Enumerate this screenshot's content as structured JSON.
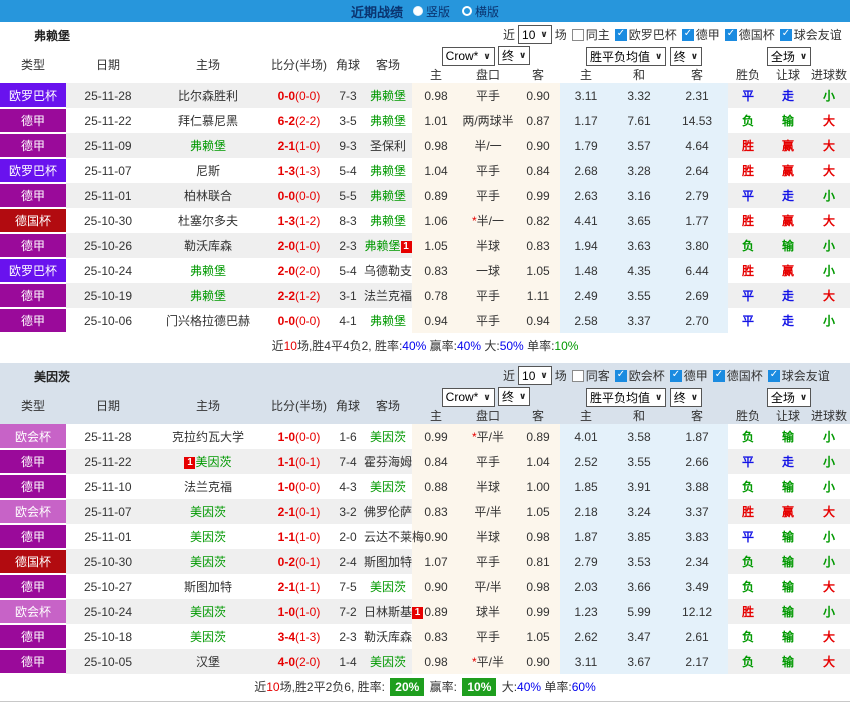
{
  "titlebar": {
    "title": "近期战绩",
    "options": [
      {
        "label": "竖版",
        "selected": true
      },
      {
        "label": "横版",
        "selected": false
      }
    ]
  },
  "colors": {
    "topbar_bg": "#2796dc",
    "title_text": "#0a3470",
    "type_colors": {
      "欧罗巴杯": "#6912ee",
      "德甲": "#9a0a9a",
      "德国杯": "#b20b10",
      "欧会杯": "#c763c7"
    },
    "focus_team": "#009900",
    "score": "#e60000",
    "result_colors": {
      "胜": "#e60000",
      "赢": "#e60000",
      "大": "#e60000",
      "平": "#1414e6",
      "走": "#1414e6",
      "负": "#009900",
      "输": "#009900",
      "小": "#009900"
    },
    "handicap_group_bg": "#fcf6ec",
    "avg_group_bg": "#e4f1fa",
    "stripe": "#efefef",
    "section2_header_bg": "#d8e1eb",
    "summary_highlight_bg": "#1e9e1e"
  },
  "row_fields": [
    "type",
    "date",
    "home",
    "home_is_focus",
    "home_badge",
    "score_ft",
    "score_ht",
    "corner",
    "away",
    "away_is_focus",
    "away_badge",
    "home_odds",
    "handicap_star",
    "handicap",
    "away_odds",
    "avg_win",
    "avg_draw",
    "avg_lose",
    "result",
    "handicap_result",
    "goals_result"
  ],
  "sections": [
    {
      "team": "弗赖堡",
      "filter": {
        "prefix": "近",
        "count": "10",
        "suffix": "场",
        "same_label": "同主",
        "same_checked": false,
        "leagues": [
          {
            "label": "欧罗巴杯",
            "checked": true
          },
          {
            "label": "德甲",
            "checked": true
          },
          {
            "label": "德国杯",
            "checked": true
          },
          {
            "label": "球会友谊",
            "checked": true
          }
        ]
      },
      "header": {
        "cols": [
          "类型",
          "日期",
          "主场",
          "比分(半场)",
          "角球",
          "客场"
        ],
        "dropdowns": [
          "Crow*",
          "终",
          "胜平负均值",
          "终",
          "全场"
        ],
        "subcols": [
          "主",
          "盘口",
          "客",
          "主",
          "和",
          "客",
          "胜负",
          "让球",
          "进球数"
        ]
      },
      "rows": [
        [
          "欧罗巴杯",
          "25-11-28",
          "比尔森胜利",
          0,
          "",
          "0-0",
          "(0-0)",
          "7-3",
          "弗赖堡",
          1,
          "",
          "0.98",
          0,
          "平手",
          "0.90",
          "3.11",
          "3.32",
          "2.31",
          "平",
          "走",
          "小"
        ],
        [
          "德甲",
          "25-11-22",
          "拜仁慕尼黑",
          0,
          "",
          "6-2",
          "(2-2)",
          "3-5",
          "弗赖堡",
          1,
          "",
          "1.01",
          0,
          "两/两球半",
          "0.87",
          "1.17",
          "7.61",
          "14.53",
          "负",
          "输",
          "大"
        ],
        [
          "德甲",
          "25-11-09",
          "弗赖堡",
          1,
          "",
          "2-1",
          "(1-0)",
          "9-3",
          "圣保利",
          0,
          "",
          "0.98",
          0,
          "半/一",
          "0.90",
          "1.79",
          "3.57",
          "4.64",
          "胜",
          "赢",
          "大"
        ],
        [
          "欧罗巴杯",
          "25-11-07",
          "尼斯",
          0,
          "",
          "1-3",
          "(1-3)",
          "5-4",
          "弗赖堡",
          1,
          "",
          "1.04",
          0,
          "平手",
          "0.84",
          "2.68",
          "3.28",
          "2.64",
          "胜",
          "赢",
          "大"
        ],
        [
          "德甲",
          "25-11-01",
          "柏林联合",
          0,
          "",
          "0-0",
          "(0-0)",
          "5-5",
          "弗赖堡",
          1,
          "",
          "0.89",
          0,
          "平手",
          "0.99",
          "2.63",
          "3.16",
          "2.79",
          "平",
          "走",
          "小"
        ],
        [
          "德国杯",
          "25-10-30",
          "杜塞尔多夫",
          0,
          "",
          "1-3",
          "(1-2)",
          "8-3",
          "弗赖堡",
          1,
          "",
          "1.06",
          1,
          "半/一",
          "0.82",
          "4.41",
          "3.65",
          "1.77",
          "胜",
          "赢",
          "大"
        ],
        [
          "德甲",
          "25-10-26",
          "勒沃库森",
          0,
          "",
          "2-0",
          "(1-0)",
          "2-3",
          "弗赖堡",
          1,
          "1",
          "1.05",
          0,
          "半球",
          "0.83",
          "1.94",
          "3.63",
          "3.80",
          "负",
          "输",
          "小"
        ],
        [
          "欧罗巴杯",
          "25-10-24",
          "弗赖堡",
          1,
          "",
          "2-0",
          "(2-0)",
          "5-4",
          "乌德勒支",
          0,
          "",
          "0.83",
          0,
          "一球",
          "1.05",
          "1.48",
          "4.35",
          "6.44",
          "胜",
          "赢",
          "小"
        ],
        [
          "德甲",
          "25-10-19",
          "弗赖堡",
          1,
          "",
          "2-2",
          "(1-2)",
          "3-1",
          "法兰克福",
          0,
          "",
          "0.78",
          0,
          "平手",
          "1.11",
          "2.49",
          "3.55",
          "2.69",
          "平",
          "走",
          "大"
        ],
        [
          "德甲",
          "25-10-06",
          "门兴格拉德巴赫",
          0,
          "",
          "0-0",
          "(0-0)",
          "4-1",
          "弗赖堡",
          1,
          "",
          "0.94",
          0,
          "平手",
          "0.94",
          "2.58",
          "3.37",
          "2.70",
          "平",
          "走",
          "小"
        ]
      ],
      "summary": [
        {
          "t": "近",
          "k": "b"
        },
        {
          "t": "10",
          "k": "r"
        },
        {
          "t": "场,胜4平4负2, 胜率:",
          "k": "b"
        },
        {
          "t": "40%",
          "k": "bl"
        },
        {
          "t": " 赢率:",
          "k": "b"
        },
        {
          "t": "40%",
          "k": "bl"
        },
        {
          "t": " 大:",
          "k": "b"
        },
        {
          "t": "50%",
          "k": "bl"
        },
        {
          "t": " 单率:",
          "k": "b"
        },
        {
          "t": "10%",
          "k": "g"
        }
      ]
    },
    {
      "team": "美因茨",
      "filter": {
        "prefix": "近",
        "count": "10",
        "suffix": "场",
        "same_label": "同客",
        "same_checked": false,
        "leagues": [
          {
            "label": "欧会杯",
            "checked": true
          },
          {
            "label": "德甲",
            "checked": true
          },
          {
            "label": "德国杯",
            "checked": true
          },
          {
            "label": "球会友谊",
            "checked": true
          }
        ]
      },
      "header": {
        "cols": [
          "类型",
          "日期",
          "主场",
          "比分(半场)",
          "角球",
          "客场"
        ],
        "dropdowns": [
          "Crow*",
          "终",
          "胜平负均值",
          "终",
          "全场"
        ],
        "subcols": [
          "主",
          "盘口",
          "客",
          "主",
          "和",
          "客",
          "胜负",
          "让球",
          "进球数"
        ]
      },
      "rows": [
        [
          "欧会杯",
          "25-11-28",
          "克拉约瓦大学",
          0,
          "",
          "1-0",
          "(0-0)",
          "1-6",
          "美因茨",
          1,
          "",
          "0.99",
          1,
          "平/半",
          "0.89",
          "4.01",
          "3.58",
          "1.87",
          "负",
          "输",
          "小"
        ],
        [
          "德甲",
          "25-11-22",
          "美因茨",
          1,
          "1",
          "1-1",
          "(0-1)",
          "7-4",
          "霍芬海姆",
          0,
          "",
          "0.84",
          0,
          "平手",
          "1.04",
          "2.52",
          "3.55",
          "2.66",
          "平",
          "走",
          "小"
        ],
        [
          "德甲",
          "25-11-10",
          "法兰克福",
          0,
          "",
          "1-0",
          "(0-0)",
          "4-3",
          "美因茨",
          1,
          "",
          "0.88",
          0,
          "半球",
          "1.00",
          "1.85",
          "3.91",
          "3.88",
          "负",
          "输",
          "小"
        ],
        [
          "欧会杯",
          "25-11-07",
          "美因茨",
          1,
          "",
          "2-1",
          "(0-1)",
          "3-2",
          "佛罗伦萨",
          0,
          "",
          "0.83",
          0,
          "平/半",
          "1.05",
          "2.18",
          "3.24",
          "3.37",
          "胜",
          "赢",
          "大"
        ],
        [
          "德甲",
          "25-11-01",
          "美因茨",
          1,
          "",
          "1-1",
          "(1-0)",
          "2-0",
          "云达不莱梅",
          0,
          "",
          "0.90",
          0,
          "半球",
          "0.98",
          "1.87",
          "3.85",
          "3.83",
          "平",
          "输",
          "小"
        ],
        [
          "德国杯",
          "25-10-30",
          "美因茨",
          1,
          "",
          "0-2",
          "(0-1)",
          "2-4",
          "斯图加特",
          0,
          "",
          "1.07",
          0,
          "平手",
          "0.81",
          "2.79",
          "3.53",
          "2.34",
          "负",
          "输",
          "小"
        ],
        [
          "德甲",
          "25-10-27",
          "斯图加特",
          0,
          "",
          "2-1",
          "(1-1)",
          "7-5",
          "美因茨",
          1,
          "",
          "0.90",
          0,
          "平/半",
          "0.98",
          "2.03",
          "3.66",
          "3.49",
          "负",
          "输",
          "大"
        ],
        [
          "欧会杯",
          "25-10-24",
          "美因茨",
          1,
          "",
          "1-0",
          "(1-0)",
          "7-2",
          "日林斯基",
          0,
          "1",
          "0.89",
          0,
          "球半",
          "0.99",
          "1.23",
          "5.99",
          "12.12",
          "胜",
          "输",
          "小"
        ],
        [
          "德甲",
          "25-10-18",
          "美因茨",
          1,
          "",
          "3-4",
          "(1-3)",
          "2-3",
          "勒沃库森",
          0,
          "",
          "0.83",
          0,
          "平手",
          "1.05",
          "2.62",
          "3.47",
          "2.61",
          "负",
          "输",
          "大"
        ],
        [
          "德甲",
          "25-10-05",
          "汉堡",
          0,
          "",
          "4-0",
          "(2-0)",
          "1-4",
          "美因茨",
          1,
          "",
          "0.98",
          1,
          "平/半",
          "0.90",
          "3.11",
          "3.67",
          "2.17",
          "负",
          "输",
          "大"
        ]
      ],
      "summary": [
        {
          "t": "近",
          "k": "b"
        },
        {
          "t": "10",
          "k": "r"
        },
        {
          "t": "场,胜2平2负6, 胜率: ",
          "k": "b"
        },
        {
          "t": "20%",
          "k": "box"
        },
        {
          "t": " 赢率: ",
          "k": "b"
        },
        {
          "t": "10%",
          "k": "box"
        },
        {
          "t": " 大:",
          "k": "b"
        },
        {
          "t": "40%",
          "k": "bl"
        },
        {
          "t": " 单率:",
          "k": "b"
        },
        {
          "t": "60%",
          "k": "bl"
        }
      ]
    }
  ]
}
